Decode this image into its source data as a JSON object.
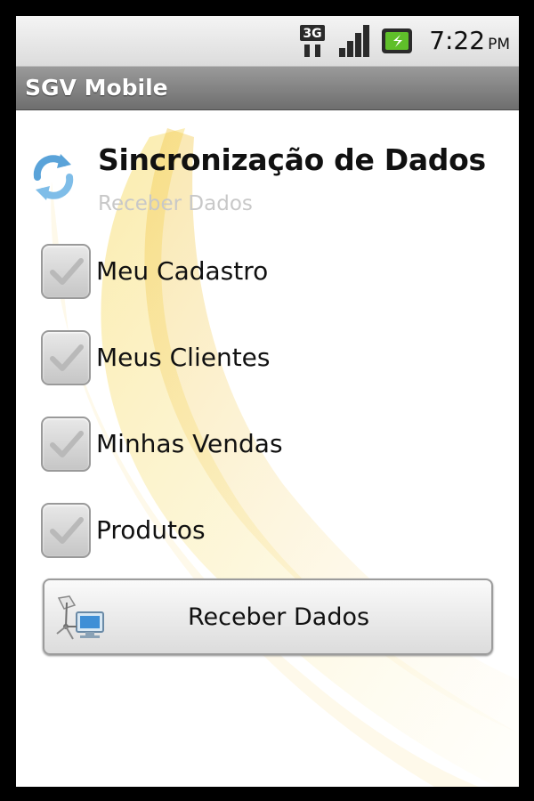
{
  "status_bar": {
    "network": "3G",
    "time": "7:22",
    "ampm": "PM",
    "icons": [
      "3g-icon",
      "signal-icon",
      "battery-icon"
    ]
  },
  "app": {
    "title": "SGV Mobile"
  },
  "screen": {
    "heading": "Sincronização de Dados",
    "subheading": "Receber Dados",
    "icon": "sync-icon"
  },
  "options": [
    {
      "label": "Meu Cadastro",
      "checked": true
    },
    {
      "label": "Meus Clientes",
      "checked": true
    },
    {
      "label": "Minhas Vendas",
      "checked": true
    },
    {
      "label": "Produtos",
      "checked": true
    }
  ],
  "receive_button": {
    "label": "Receber Dados",
    "icon": "network-computer-icon"
  },
  "colors": {
    "title_bar": "#7f7f7f",
    "checkmark": "#b8b8b8",
    "accent_art": "#f5d24a"
  }
}
